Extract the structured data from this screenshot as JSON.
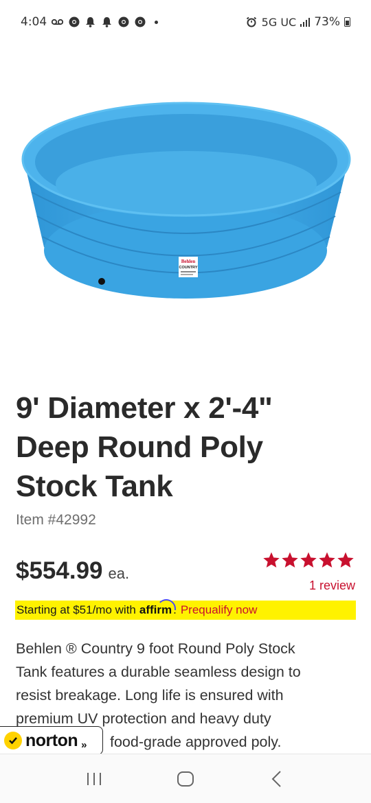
{
  "status_bar": {
    "time": "4:04",
    "network": "5G UC",
    "battery": "73%"
  },
  "product": {
    "title_lines": [
      "9' Diameter x 2'-4\"",
      "Deep Round Poly",
      "Stock Tank"
    ],
    "item_number": "Item #42992",
    "price": "$554.99",
    "price_unit": "ea.",
    "rating": 5,
    "review_link": "1 review",
    "tank_label_lines": [
      "Behlen",
      "COUNTRY"
    ]
  },
  "affirm": {
    "text_before": "Starting at $51/mo with",
    "logo": "affirm",
    "period": ".",
    "prequalify": "Prequalify now"
  },
  "description": {
    "lines": [
      "Behlen ® Country 9 foot Round Poly Stock",
      "Tank features a durable seamless design to",
      "resist breakage. Long life is ensured with",
      "premium UV protection and heavy duty",
      "food-grade approved poly."
    ]
  },
  "norton": {
    "label": "norton",
    "arrow": "»"
  },
  "icons": {
    "nav_recents": "recents-icon",
    "nav_home": "home-icon",
    "nav_back": "back-icon"
  },
  "colors": {
    "accent_red": "#c8102e",
    "affirm_yellow": "#fff200",
    "tank_blue": "#3fa9e6"
  }
}
